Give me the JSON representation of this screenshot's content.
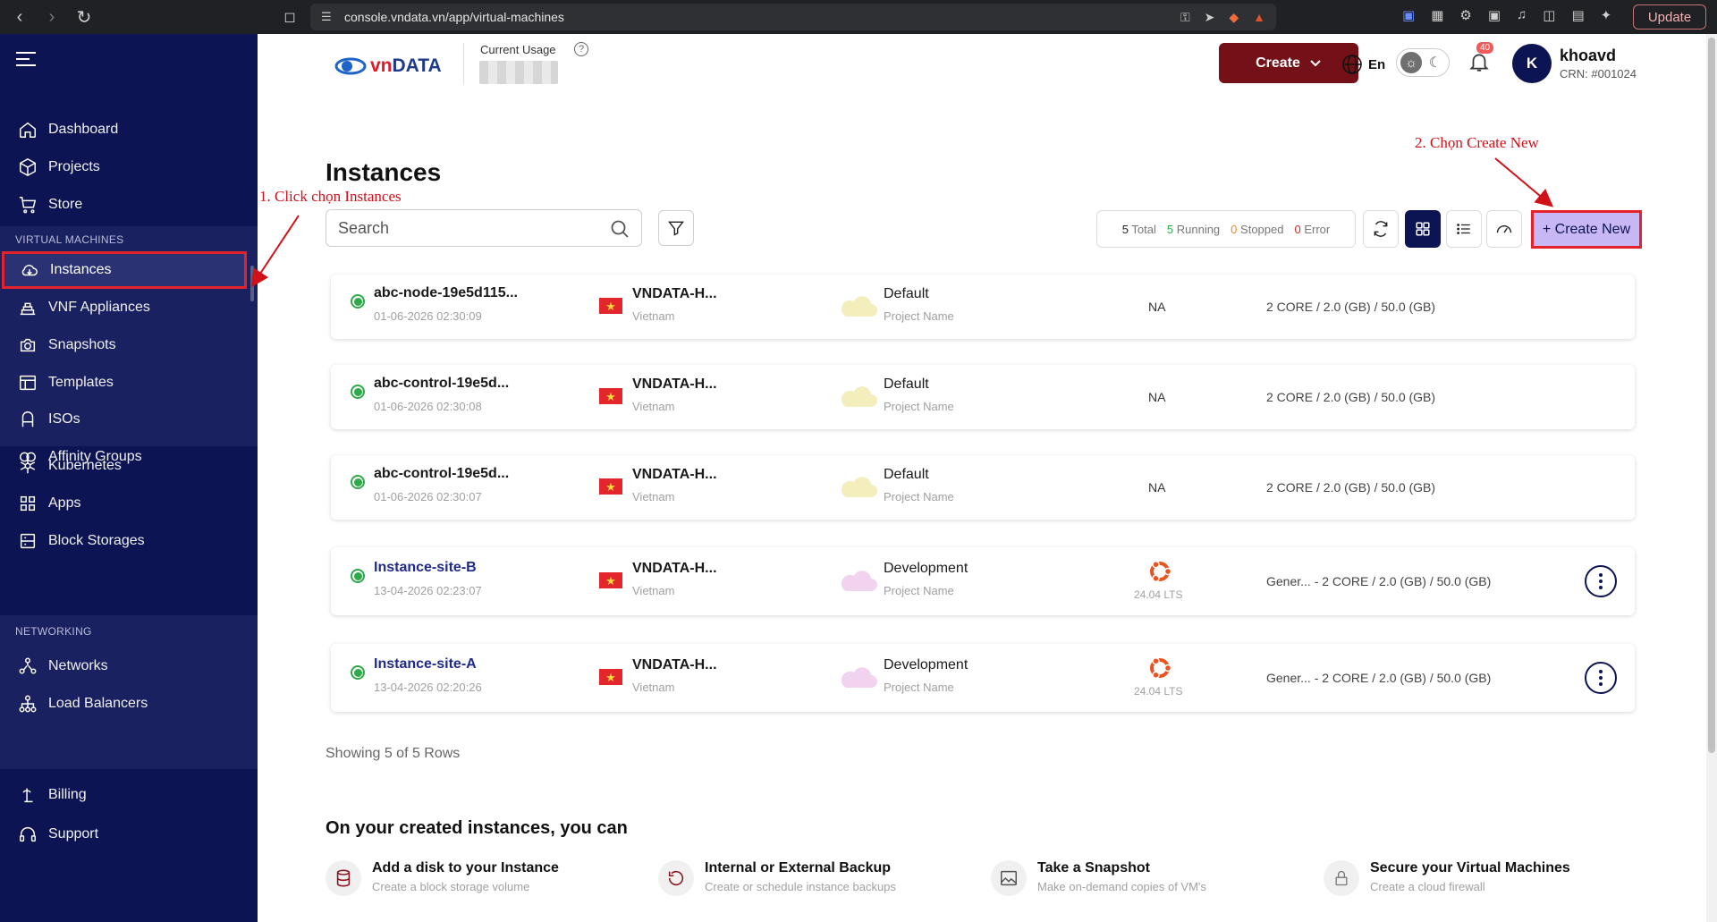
{
  "browser": {
    "url": "console.vndata.vn/app/virtual-machines",
    "update_label": "Update"
  },
  "header": {
    "logo_prefix": "vn",
    "logo_suffix": "DATA",
    "usage_label": "Current Usage",
    "create_label": "Create",
    "lang_label": "En",
    "notification_count": "40",
    "avatar_letter": "K",
    "user_name": "khoavd",
    "user_crn": "CRN: #001024"
  },
  "sidebar": {
    "top_items": [
      {
        "label": "Dashboard",
        "icon": "home-icon"
      },
      {
        "label": "Projects",
        "icon": "box-icon"
      },
      {
        "label": "Store",
        "icon": "cart-icon"
      }
    ],
    "vm_section_label": "VIRTUAL MACHINES",
    "vm_items": [
      {
        "label": "Instances",
        "icon": "cloud-icon",
        "active": true
      },
      {
        "label": "VNF Appliances",
        "icon": "appliance-icon"
      },
      {
        "label": "Snapshots",
        "icon": "snapshot-icon"
      },
      {
        "label": "Templates",
        "icon": "template-icon"
      },
      {
        "label": "ISOs",
        "icon": "iso-icon"
      },
      {
        "label": "Affinity Groups",
        "icon": "affinity-icon"
      }
    ],
    "mid_items": [
      {
        "label": "Kubernetes",
        "icon": "kubernetes-icon"
      },
      {
        "label": "Apps",
        "icon": "apps-icon"
      },
      {
        "label": "Block Storages",
        "icon": "storage-icon"
      }
    ],
    "net_section_label": "NETWORKING",
    "net_items": [
      {
        "label": "Networks",
        "icon": "network-icon"
      },
      {
        "label": "Load Balancers",
        "icon": "loadbalancer-icon"
      }
    ],
    "bottom_items": [
      {
        "label": "Billing",
        "icon": "billing-icon"
      },
      {
        "label": "Support",
        "icon": "support-icon"
      }
    ]
  },
  "main": {
    "title": "Instances",
    "search_placeholder": "Search",
    "status": {
      "total_count": "5",
      "total_label": "Total",
      "running_count": "5",
      "running_label": "Running",
      "stopped_count": "0",
      "stopped_label": "Stopped",
      "error_count": "0",
      "error_label": "Error"
    },
    "create_new_label": "+ Create New",
    "instances": [
      {
        "name": "abc-node-19e5d115...",
        "date": "01-06-2026 02:30:09",
        "region": "VNDATA-H...",
        "country": "Vietnam",
        "project": "Default",
        "project_label": "Project Name",
        "os": "NA",
        "os_version": "",
        "spec": "2 CORE / 2.0 (GB) / 50.0 (GB)",
        "link": false,
        "has_menu": false
      },
      {
        "name": "abc-control-19e5d...",
        "date": "01-06-2026 02:30:08",
        "region": "VNDATA-H...",
        "country": "Vietnam",
        "project": "Default",
        "project_label": "Project Name",
        "os": "NA",
        "os_version": "",
        "spec": "2 CORE / 2.0 (GB) / 50.0 (GB)",
        "link": false,
        "has_menu": false
      },
      {
        "name": "abc-control-19e5d...",
        "date": "01-06-2026 02:30:07",
        "region": "VNDATA-H...",
        "country": "Vietnam",
        "project": "Default",
        "project_label": "Project Name",
        "os": "NA",
        "os_version": "",
        "spec": "2 CORE / 2.0 (GB) / 50.0 (GB)",
        "link": false,
        "has_menu": false
      },
      {
        "name": "Instance-site-B",
        "date": "13-04-2026 02:23:07",
        "region": "VNDATA-H...",
        "country": "Vietnam",
        "project": "Development",
        "project_label": "Project Name",
        "os": "",
        "os_version": "24.04 LTS",
        "spec": "Gener... - 2 CORE / 2.0 (GB) / 50.0 (GB)",
        "link": true,
        "has_menu": true
      },
      {
        "name": "Instance-site-A",
        "date": "13-04-2026 02:20:26",
        "region": "VNDATA-H...",
        "country": "Vietnam",
        "project": "Development",
        "project_label": "Project Name",
        "os": "",
        "os_version": "24.04 LTS",
        "spec": "Gener... - 2 CORE / 2.0 (GB) / 50.0 (GB)",
        "link": true,
        "has_menu": true
      }
    ],
    "showing_text": "Showing 5 of 5 Rows",
    "features_title": "On your created instances, you can",
    "features": [
      {
        "title": "Add a disk to your Instance",
        "desc": "Create a block storage volume",
        "icon": "database-icon"
      },
      {
        "title": "Internal or External Backup",
        "desc": "Create or schedule instance backups",
        "icon": "backup-icon"
      },
      {
        "title": "Take a Snapshot",
        "desc": "Make on-demand copies of VM's",
        "icon": "image-icon"
      },
      {
        "title": "Secure your Virtual Machines",
        "desc": "Create a cloud firewall",
        "icon": "lock-icon"
      }
    ]
  },
  "annotations": {
    "step1": "1. Click chọn Instances",
    "step2": "2. Chọn Create New"
  },
  "colors": {
    "sidebar_bg": "#0c1453",
    "create_button": "#741118",
    "create_new_bg": "#c8b7f5",
    "running": "#2eaa4a",
    "annotation": "#d0111a"
  }
}
